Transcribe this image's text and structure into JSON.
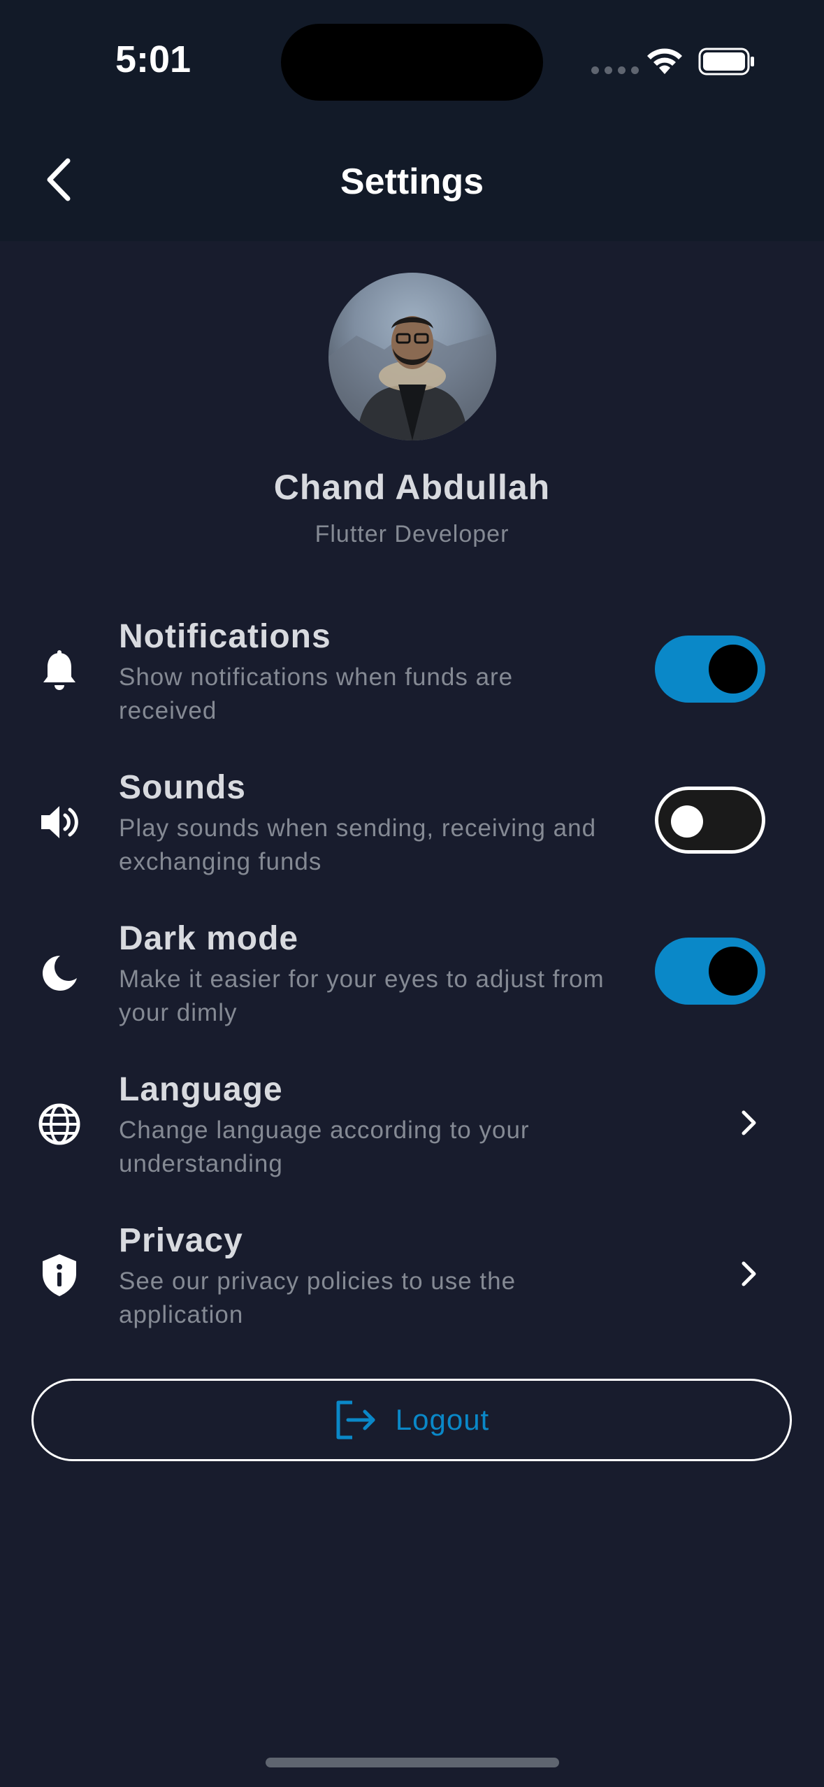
{
  "status_bar": {
    "time": "5:01"
  },
  "header": {
    "title": "Settings",
    "back_icon": "chevron-left-icon"
  },
  "profile": {
    "name": "Chand Abdullah",
    "role": "Flutter Developer"
  },
  "settings": [
    {
      "icon": "bell-icon",
      "title": "Notifications",
      "description": "Show notifications when funds are received",
      "control": "toggle",
      "enabled": true
    },
    {
      "icon": "speaker-icon",
      "title": "Sounds",
      "description": "Play sounds when sending, receiving and exchanging funds",
      "control": "toggle",
      "enabled": false
    },
    {
      "icon": "moon-icon",
      "title": "Dark mode",
      "description": "Make it easier for your eyes to adjust from your dimly",
      "control": "toggle",
      "enabled": true
    },
    {
      "icon": "globe-icon",
      "title": "Language",
      "description": "Change language according to your understanding",
      "control": "chevron"
    },
    {
      "icon": "shield-info-icon",
      "title": "Privacy",
      "description": "See our privacy policies to use the application",
      "control": "chevron"
    }
  ],
  "logout": {
    "label": "Logout",
    "icon": "logout-icon"
  },
  "colors": {
    "background": "#181c2d",
    "header_background": "#121a28",
    "accent": "#0a88c8",
    "title_text": "#d8dadf",
    "secondary_text": "#858a94"
  }
}
